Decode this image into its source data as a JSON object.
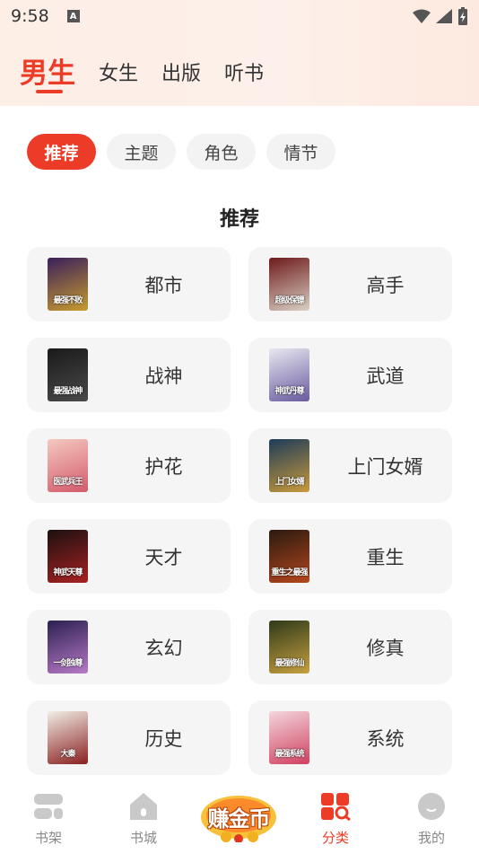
{
  "status": {
    "time": "9:58",
    "notif": "A"
  },
  "top_tabs": [
    {
      "label": "男生",
      "active": true
    },
    {
      "label": "女生",
      "active": false
    },
    {
      "label": "出版",
      "active": false
    },
    {
      "label": "听书",
      "active": false
    }
  ],
  "chips": [
    {
      "label": "推荐",
      "active": true
    },
    {
      "label": "主题",
      "active": false
    },
    {
      "label": "角色",
      "active": false
    },
    {
      "label": "情节",
      "active": false
    }
  ],
  "section_title": "推荐",
  "categories": [
    {
      "label": "都市",
      "cover_text": "最强不败",
      "colors": [
        "#3a1f5c",
        "#c89b2e"
      ]
    },
    {
      "label": "高手",
      "cover_text": "超级保镖",
      "colors": [
        "#6e1a1a",
        "#d9d0c4"
      ]
    },
    {
      "label": "战神",
      "cover_text": "最强战神",
      "colors": [
        "#1a1a1a",
        "#4a4a4a"
      ]
    },
    {
      "label": "武道",
      "cover_text": "神武丹尊",
      "colors": [
        "#e8e8f0",
        "#6a5aa0"
      ]
    },
    {
      "label": "护花",
      "cover_text": "医武兵王",
      "colors": [
        "#f4c9c0",
        "#d35a6a"
      ]
    },
    {
      "label": "上门女婿",
      "cover_text": "上门女婿",
      "colors": [
        "#1d3b5a",
        "#c99a3a"
      ]
    },
    {
      "label": "天才",
      "cover_text": "神武天尊",
      "colors": [
        "#1c1010",
        "#a82222"
      ]
    },
    {
      "label": "重生",
      "cover_text": "重生之最强",
      "colors": [
        "#2a1a10",
        "#b5461e"
      ]
    },
    {
      "label": "玄幻",
      "cover_text": "一剑独尊",
      "colors": [
        "#2b2050",
        "#b87ac8"
      ]
    },
    {
      "label": "修真",
      "cover_text": "最强修仙",
      "colors": [
        "#2e3a1a",
        "#c8a040"
      ]
    },
    {
      "label": "历史",
      "cover_text": "大秦",
      "colors": [
        "#f1eee6",
        "#8a2020"
      ]
    },
    {
      "label": "系统",
      "cover_text": "最强系统",
      "colors": [
        "#f3d6dc",
        "#d04060"
      ]
    }
  ],
  "bottom_nav": [
    {
      "label": "书架",
      "icon": "bookshelf-icon",
      "active": false
    },
    {
      "label": "书城",
      "icon": "bookstore-icon",
      "active": false
    },
    {
      "label": "分类",
      "icon": "category-icon",
      "active": true
    },
    {
      "label": "我的",
      "icon": "profile-icon",
      "active": false
    }
  ],
  "earn_label": "赚金币",
  "colors": {
    "accent": "#ec3b26",
    "card_bg": "#f5f5f5",
    "chip_bg": "#f3f3f3"
  }
}
